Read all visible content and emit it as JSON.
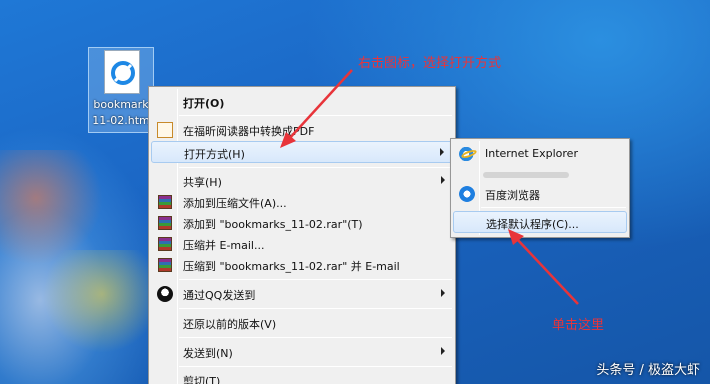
{
  "desktop": {
    "file": {
      "label_line1": "bookmark",
      "label_line2": "11-02.htm"
    }
  },
  "context_menu": {
    "open": "打开(O)",
    "convert_pdf": "在福昕阅读器中转换成PDF",
    "open_with": "打开方式(H)",
    "share": "共享(H)",
    "add_archive": "添加到压缩文件(A)...",
    "add_rar": "添加到 \"bookmarks_11-02.rar\"(T)",
    "compress_email": "压缩并 E-mail...",
    "compress_rar_email": "压缩到 \"bookmarks_11-02.rar\" 并 E-mail",
    "send_qq": "通过QQ发送到",
    "restore": "还原以前的版本(V)",
    "send_to": "发送到(N)",
    "cut": "剪切(T)"
  },
  "open_with_submenu": {
    "ie": "Internet Explorer",
    "baidu": "百度浏览器",
    "choose_default": "选择默认程序(C)..."
  },
  "annotations": {
    "top": "右击图标，选择打开方式",
    "bottom": "单击这里",
    "color": "#e8343a"
  },
  "watermark": "头条号 / 极盗大虾"
}
